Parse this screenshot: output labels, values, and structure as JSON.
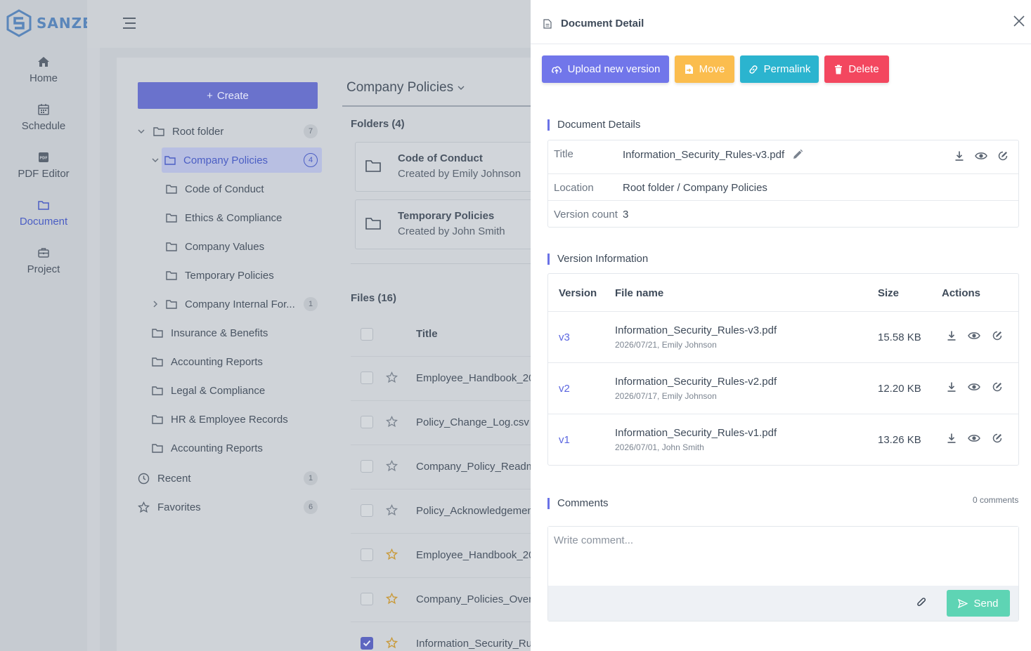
{
  "app": {
    "brand": "SANZE",
    "nav": [
      {
        "label": "Home",
        "icon": "home-icon"
      },
      {
        "label": "Schedule",
        "icon": "calendar-icon"
      },
      {
        "label": "PDF Editor",
        "icon": "pdf-icon"
      },
      {
        "label": "Document",
        "icon": "folder-icon",
        "active": true
      },
      {
        "label": "Project",
        "icon": "briefcase-icon"
      }
    ]
  },
  "tree": {
    "create_label": "Create",
    "items": [
      {
        "label": "Root folder",
        "count": "7"
      },
      {
        "label": "Company Policies",
        "count": "4"
      },
      {
        "label": "Code of Conduct"
      },
      {
        "label": "Ethics & Compliance"
      },
      {
        "label": "Company Values"
      },
      {
        "label": "Temporary Policies"
      },
      {
        "label": "Company Internal For...",
        "count": "1"
      },
      {
        "label": "Insurance & Benefits"
      },
      {
        "label": "Accounting Reports"
      },
      {
        "label": "Legal & Compliance"
      },
      {
        "label": "HR & Employee Records"
      },
      {
        "label": "Accounting Reports"
      },
      {
        "label": "Recent",
        "count": "1"
      },
      {
        "label": "Favorites",
        "count": "6"
      }
    ]
  },
  "listing": {
    "title": "Company Policies",
    "folders_head": "Folders (4)",
    "folders": [
      {
        "name": "Code of Conduct",
        "by": "Created by Emily Johnson"
      },
      {
        "name": "Temporary Policies",
        "by": "Created by John Smith"
      }
    ],
    "files_head": "Files (16)",
    "title_col": "Title",
    "files": [
      {
        "name": "Employee_Handbook_20",
        "starred": false,
        "checked": false
      },
      {
        "name": "Policy_Change_Log.csv",
        "starred": false,
        "checked": false
      },
      {
        "name": "Company_Policy_Readme",
        "starred": false,
        "checked": false
      },
      {
        "name": "Policy_Acknowledgemen",
        "starred": false,
        "checked": false
      },
      {
        "name": "Employee_Handbook_20",
        "starred": true,
        "checked": false
      },
      {
        "name": "Company_Policies_Overv",
        "starred": true,
        "checked": false
      },
      {
        "name": "Information_Security_Rul",
        "starred": true,
        "checked": true
      }
    ]
  },
  "drawer": {
    "title": "Document Detail",
    "buttons": {
      "upload": "Upload new version",
      "move": "Move",
      "permalink": "Permalink",
      "delete": "Delete"
    },
    "details": {
      "section": "Document Details",
      "title_label": "Title",
      "title_value": "Information_Security_Rules-v3.pdf",
      "location_label": "Location",
      "location_value": "Root folder / Company Policies",
      "count_label": "Version count",
      "count_value": "3"
    },
    "versions": {
      "section": "Version Information",
      "columns": [
        "Version",
        "File name",
        "Size",
        "Actions"
      ],
      "rows": [
        {
          "version": "v3",
          "file": "Information_Security_Rules-v3.pdf",
          "meta": "2026/07/21, Emily Johnson",
          "size": "15.58 KB"
        },
        {
          "version": "v2",
          "file": "Information_Security_Rules-v2.pdf",
          "meta": "2026/07/17, Emily Johnson",
          "size": "12.20 KB"
        },
        {
          "version": "v1",
          "file": "Information_Security_Rules-v1.pdf",
          "meta": "2026/07/01, John Smith",
          "size": "13.26 KB"
        }
      ]
    },
    "comments": {
      "section": "Comments",
      "count": "0 comments",
      "placeholder": "Write comment...",
      "send": "Send"
    }
  },
  "colors": {
    "primary": "#7176ea",
    "warning": "#fbbd4e",
    "info": "#2bb4cf",
    "danger": "#f3475f",
    "success": "#5ed4b4"
  }
}
